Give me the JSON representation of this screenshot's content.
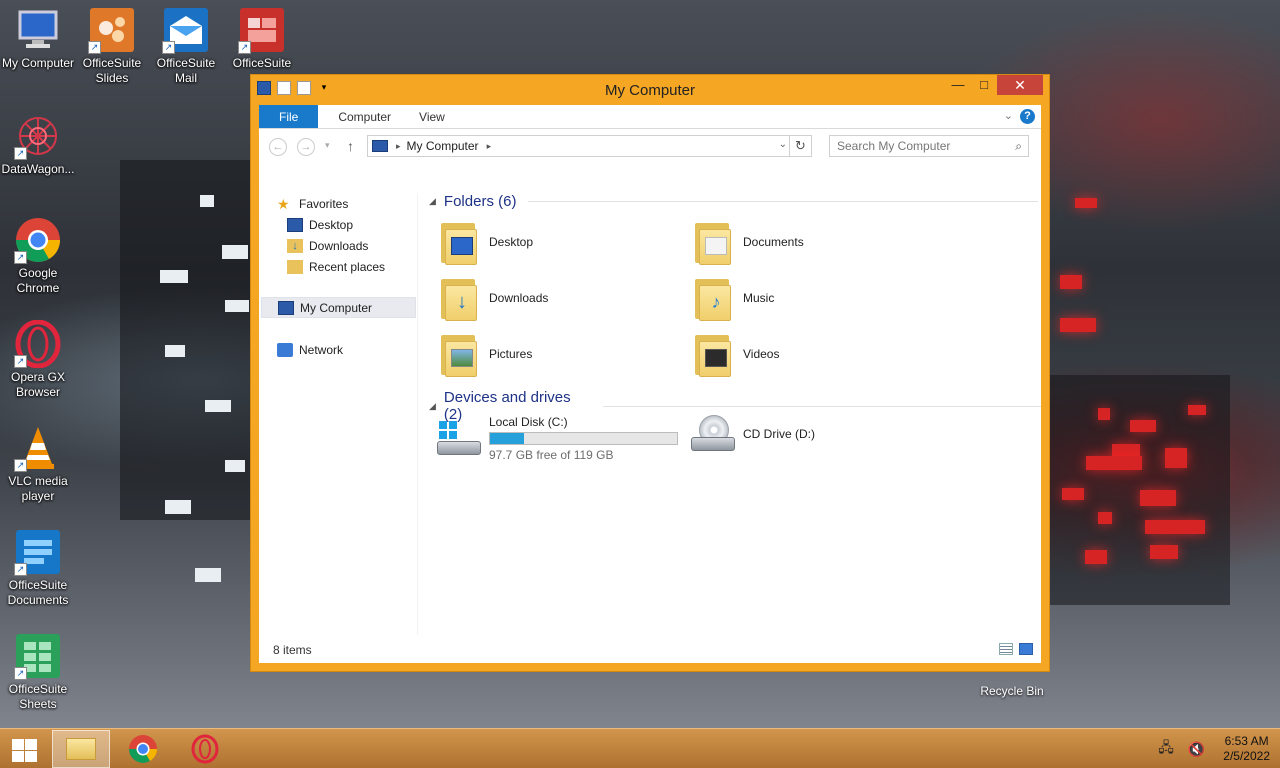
{
  "desktop": {
    "icons": [
      {
        "label": "My Computer",
        "icon": "computer-icon"
      },
      {
        "label": "OfficeSuite Slides",
        "icon": "slides-icon"
      },
      {
        "label": "OfficeSuite Mail",
        "icon": "mail-icon"
      },
      {
        "label": "OfficeSuite",
        "icon": "officesuite-icon"
      },
      {
        "label": "DataWagon...",
        "icon": "datawagon-icon"
      },
      {
        "label": "Google Chrome",
        "icon": "chrome-icon"
      },
      {
        "label": "Opera GX Browser",
        "icon": "opera-icon"
      },
      {
        "label": "VLC media player",
        "icon": "vlc-icon"
      },
      {
        "label": "OfficeSuite Documents",
        "icon": "documents-icon"
      },
      {
        "label": "OfficeSuite Sheets",
        "icon": "sheets-icon"
      }
    ],
    "recycle_bin": "Recycle Bin"
  },
  "window": {
    "title": "My Computer",
    "minimize": "—",
    "maximize": "□",
    "close": "✕",
    "ribbon": {
      "file": "File",
      "tabs": [
        "Computer",
        "View"
      ],
      "help": "?"
    },
    "address": {
      "path": "My Computer",
      "search_placeholder": "Search My Computer"
    },
    "nav": {
      "favorites": "Favorites",
      "desktop": "Desktop",
      "downloads": "Downloads",
      "recent": "Recent places",
      "my_computer": "My Computer",
      "network": "Network"
    },
    "folders_header": "Folders (6)",
    "folders": [
      {
        "name": "Desktop",
        "icon": "desktop-folder-icon"
      },
      {
        "name": "Documents",
        "icon": "documents-folder-icon"
      },
      {
        "name": "Downloads",
        "icon": "downloads-folder-icon"
      },
      {
        "name": "Music",
        "icon": "music-folder-icon"
      },
      {
        "name": "Pictures",
        "icon": "pictures-folder-icon"
      },
      {
        "name": "Videos",
        "icon": "videos-folder-icon"
      }
    ],
    "devices_header": "Devices and drives (2)",
    "drives": {
      "local": {
        "name": "Local Disk (C:)",
        "free_text": "97.7 GB free of 119 GB",
        "used_fraction": 0.18
      },
      "cd": {
        "name": "CD Drive (D:)"
      }
    },
    "status": "8 items"
  },
  "taskbar": {
    "time": "6:53 AM",
    "date": "2/5/2022"
  },
  "colors": {
    "window_frame": "#f5a623",
    "accent": "#1979ca",
    "close": "#c7443a",
    "progress": "#26a0da"
  }
}
